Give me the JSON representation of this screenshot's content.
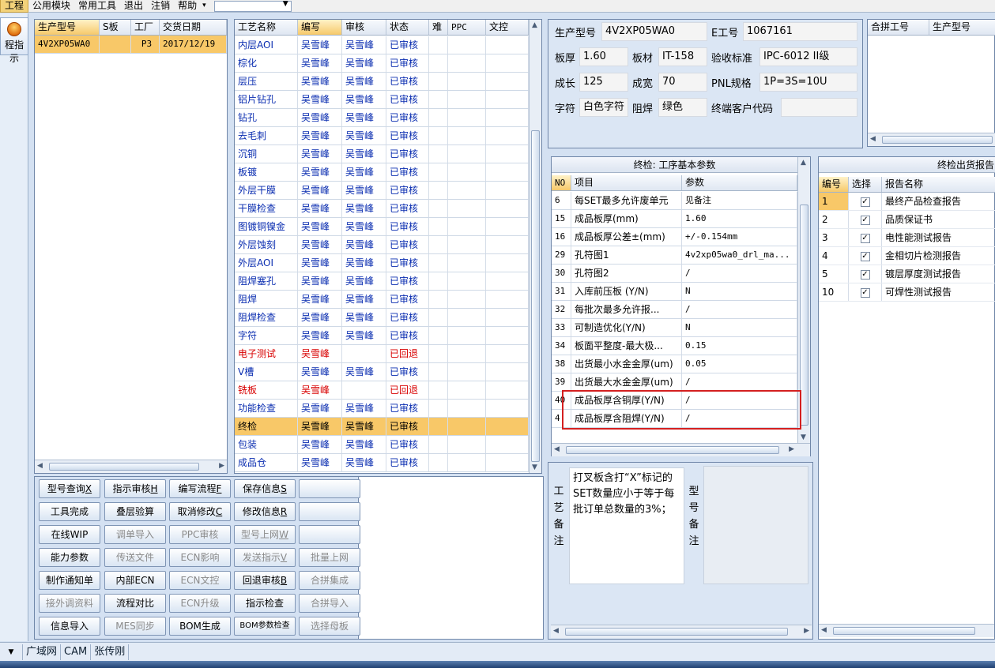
{
  "menu": {
    "items": [
      "工程",
      "公用模块",
      "常用工具",
      "退出",
      "注销",
      "帮助"
    ],
    "dropdown_arrow": "▾"
  },
  "left_toolbar": {
    "indicator_label": "程指示",
    "indicator_icon": "orange-orb-icon"
  },
  "order_table": {
    "columns": [
      "生产型号",
      "S板",
      "工厂",
      "交货日期"
    ],
    "rows": [
      {
        "model": "4V2XP05WA0",
        "s": "",
        "factory": "P3",
        "date": "2017/12/19"
      }
    ]
  },
  "process_table": {
    "columns": [
      "工艺名称",
      "编写",
      "审核",
      "状态",
      "难",
      "PPC",
      "文控"
    ],
    "rows": [
      {
        "name": "内层AOI",
        "writer": "吴雪峰",
        "reviewer": "吴雪峰",
        "status": "已审核",
        "rejected": false
      },
      {
        "name": "棕化",
        "writer": "吴雪峰",
        "reviewer": "吴雪峰",
        "status": "已审核",
        "rejected": false
      },
      {
        "name": "层压",
        "writer": "吴雪峰",
        "reviewer": "吴雪峰",
        "status": "已审核",
        "rejected": false
      },
      {
        "name": "铝片钻孔",
        "writer": "吴雪峰",
        "reviewer": "吴雪峰",
        "status": "已审核",
        "rejected": false
      },
      {
        "name": "钻孔",
        "writer": "吴雪峰",
        "reviewer": "吴雪峰",
        "status": "已审核",
        "rejected": false
      },
      {
        "name": "去毛刺",
        "writer": "吴雪峰",
        "reviewer": "吴雪峰",
        "status": "已审核",
        "rejected": false
      },
      {
        "name": "沉铜",
        "writer": "吴雪峰",
        "reviewer": "吴雪峰",
        "status": "已审核",
        "rejected": false
      },
      {
        "name": "板镀",
        "writer": "吴雪峰",
        "reviewer": "吴雪峰",
        "status": "已审核",
        "rejected": false
      },
      {
        "name": "外层干膜",
        "writer": "吴雪峰",
        "reviewer": "吴雪峰",
        "status": "已审核",
        "rejected": false
      },
      {
        "name": "干膜检查",
        "writer": "吴雪峰",
        "reviewer": "吴雪峰",
        "status": "已审核",
        "rejected": false
      },
      {
        "name": "图镀铜镍金",
        "writer": "吴雪峰",
        "reviewer": "吴雪峰",
        "status": "已审核",
        "rejected": false
      },
      {
        "name": "外层蚀刻",
        "writer": "吴雪峰",
        "reviewer": "吴雪峰",
        "status": "已审核",
        "rejected": false
      },
      {
        "name": "外层AOI",
        "writer": "吴雪峰",
        "reviewer": "吴雪峰",
        "status": "已审核",
        "rejected": false
      },
      {
        "name": "阻焊塞孔",
        "writer": "吴雪峰",
        "reviewer": "吴雪峰",
        "status": "已审核",
        "rejected": false
      },
      {
        "name": "阻焊",
        "writer": "吴雪峰",
        "reviewer": "吴雪峰",
        "status": "已审核",
        "rejected": false
      },
      {
        "name": "阻焊检查",
        "writer": "吴雪峰",
        "reviewer": "吴雪峰",
        "status": "已审核",
        "rejected": false
      },
      {
        "name": "字符",
        "writer": "吴雪峰",
        "reviewer": "吴雪峰",
        "status": "已审核",
        "rejected": false
      },
      {
        "name": "电子测试",
        "writer": "吴雪峰",
        "reviewer": "",
        "status": "已回退",
        "rejected": true
      },
      {
        "name": "V槽",
        "writer": "吴雪峰",
        "reviewer": "吴雪峰",
        "status": "已审核",
        "rejected": false
      },
      {
        "name": "铣板",
        "writer": "吴雪峰",
        "reviewer": "",
        "status": "已回退",
        "rejected": true
      },
      {
        "name": "功能检查",
        "writer": "吴雪峰",
        "reviewer": "吴雪峰",
        "status": "已审核",
        "rejected": false
      },
      {
        "name": "终检",
        "writer": "吴雪峰",
        "reviewer": "吴雪峰",
        "status": "已审核",
        "rejected": false
      },
      {
        "name": "包装",
        "writer": "吴雪峰",
        "reviewer": "吴雪峰",
        "status": "已审核",
        "rejected": false
      },
      {
        "name": "成品仓",
        "writer": "吴雪峰",
        "reviewer": "吴雪峰",
        "status": "已审核",
        "rejected": false
      }
    ],
    "selected_index": 21
  },
  "buttons": [
    [
      {
        "label": "型号查询",
        "key": "X",
        "enabled": true
      },
      {
        "label": "指示审核",
        "key": "H",
        "enabled": true
      },
      {
        "label": "编写流程",
        "key": "F",
        "enabled": true
      },
      {
        "label": "保存信息",
        "key": "S",
        "enabled": true
      },
      {
        "label": "",
        "key": "",
        "enabled": true
      }
    ],
    [
      {
        "label": "工具完成",
        "key": "",
        "enabled": true
      },
      {
        "label": "叠层验算",
        "key": "",
        "enabled": true
      },
      {
        "label": "取消修改",
        "key": "C",
        "enabled": true
      },
      {
        "label": "修改信息",
        "key": "R",
        "enabled": true
      },
      {
        "label": "",
        "key": "",
        "enabled": true
      }
    ],
    [
      {
        "label": "在线WIP",
        "key": "",
        "enabled": true
      },
      {
        "label": "调单导入",
        "key": "",
        "enabled": false
      },
      {
        "label": "PPC审核",
        "key": "",
        "enabled": false
      },
      {
        "label": "型号上网",
        "key": "W",
        "enabled": false
      },
      {
        "label": "",
        "key": "",
        "enabled": true
      }
    ],
    [
      {
        "label": "能力参数",
        "key": "",
        "enabled": true
      },
      {
        "label": "传送文件",
        "key": "",
        "enabled": false
      },
      {
        "label": "ECN影响",
        "key": "",
        "enabled": false
      },
      {
        "label": "发送指示",
        "key": "V",
        "enabled": false
      },
      {
        "label": "批量上网",
        "key": "",
        "enabled": false
      }
    ],
    [
      {
        "label": "制作通知单",
        "key": "",
        "enabled": true
      },
      {
        "label": "内部ECN",
        "key": "",
        "enabled": true
      },
      {
        "label": "ECN文控",
        "key": "",
        "enabled": false
      },
      {
        "label": "回退审核",
        "key": "B",
        "enabled": true
      },
      {
        "label": "合拼集成",
        "key": "",
        "enabled": false
      }
    ],
    [
      {
        "label": "接外调资料",
        "key": "",
        "enabled": false
      },
      {
        "label": "流程对比",
        "key": "",
        "enabled": true
      },
      {
        "label": "ECN升级",
        "key": "",
        "enabled": false
      },
      {
        "label": "指示检查",
        "key": "",
        "enabled": true
      },
      {
        "label": "合拼导入",
        "key": "",
        "enabled": false
      }
    ],
    [
      {
        "label": "信息导入",
        "key": "",
        "enabled": true
      },
      {
        "label": "MES同步",
        "key": "",
        "enabled": false
      },
      {
        "label": "BOM生成",
        "key": "",
        "enabled": true
      },
      {
        "label": "BOM参数检查",
        "key": "",
        "enabled": true
      },
      {
        "label": "选择母板",
        "key": "",
        "enabled": false
      }
    ]
  ],
  "info": {
    "model_label": "生产型号",
    "model": "4V2XP05WA0",
    "eno_label": "E工号",
    "eno": "1067161",
    "thick_label": "板厚",
    "thick": "1.60",
    "mat_label": "板材",
    "mat": "IT-158",
    "std_label": "验收标准",
    "std": "IPC-6012 II级",
    "len_label": "成长",
    "len": "125",
    "wid_label": "成宽",
    "wid": "70",
    "pnl_label": "PNL规格",
    "pnl": "1P=3S=10U",
    "char_label": "字符",
    "char": "白色字符",
    "mask_label": "阻焊",
    "mask": "绿色",
    "cust_label": "终端客户代码",
    "cust": ""
  },
  "combo_table": {
    "columns": [
      "合拼工号",
      "生产型号"
    ]
  },
  "param_panel": {
    "title": "终检: 工序基本参数",
    "columns": [
      "NO",
      "项目",
      "参数"
    ],
    "rows": [
      {
        "no": "6",
        "item": "每SET最多允许废单元",
        "value": "见备注"
      },
      {
        "no": "15",
        "item": "成品板厚(mm)",
        "value": "1.60"
      },
      {
        "no": "16",
        "item": "成品板厚公差±(mm)",
        "value": "+/-0.154mm"
      },
      {
        "no": "29",
        "item": "孔符图1",
        "value": "4v2xp05wa0_drl_ma..."
      },
      {
        "no": "30",
        "item": "孔符图2",
        "value": "/"
      },
      {
        "no": "31",
        "item": "入库前压板 (Y/N)",
        "value": "N"
      },
      {
        "no": "32",
        "item": "每批次最多允许报...",
        "value": "/"
      },
      {
        "no": "33",
        "item": "可制造优化(Y/N)",
        "value": "N"
      },
      {
        "no": "34",
        "item": "板面平整度-最大极...",
        "value": "0.15"
      },
      {
        "no": "38",
        "item": "出货最小水金金厚(um)",
        "value": "0.05"
      },
      {
        "no": "39",
        "item": "出货最大水金金厚(um)",
        "value": "/"
      },
      {
        "no": "40",
        "item": "成品板厚含铜厚(Y/N)",
        "value": "/"
      },
      {
        "no": "4",
        "item": "成品板厚含阻焊(Y/N)",
        "value": "/"
      }
    ],
    "highlight_color": "#d42020"
  },
  "report_panel": {
    "title": "终检出货报告",
    "columns": [
      "编号",
      "选择",
      "报告名称"
    ],
    "rows": [
      {
        "no": "1",
        "name": "最终产品检查报告"
      },
      {
        "no": "2",
        "name": "品质保证书"
      },
      {
        "no": "3",
        "name": "电性能测试报告"
      },
      {
        "no": "4",
        "name": "金相切片检测报告"
      },
      {
        "no": "5",
        "name": "镀层厚度测试报告"
      },
      {
        "no": "10",
        "name": "可焊性测试报告"
      }
    ]
  },
  "remarks": {
    "process_label": [
      "工",
      "艺",
      "备",
      "注"
    ],
    "process_text": "打叉板含打“X”标记的SET数量应小于等于每批订单总数量的3%；",
    "model_label": [
      "型",
      "号",
      "备",
      "注"
    ]
  },
  "status_bar": {
    "items": [
      "广域网",
      "CAM",
      "张传刚"
    ]
  }
}
